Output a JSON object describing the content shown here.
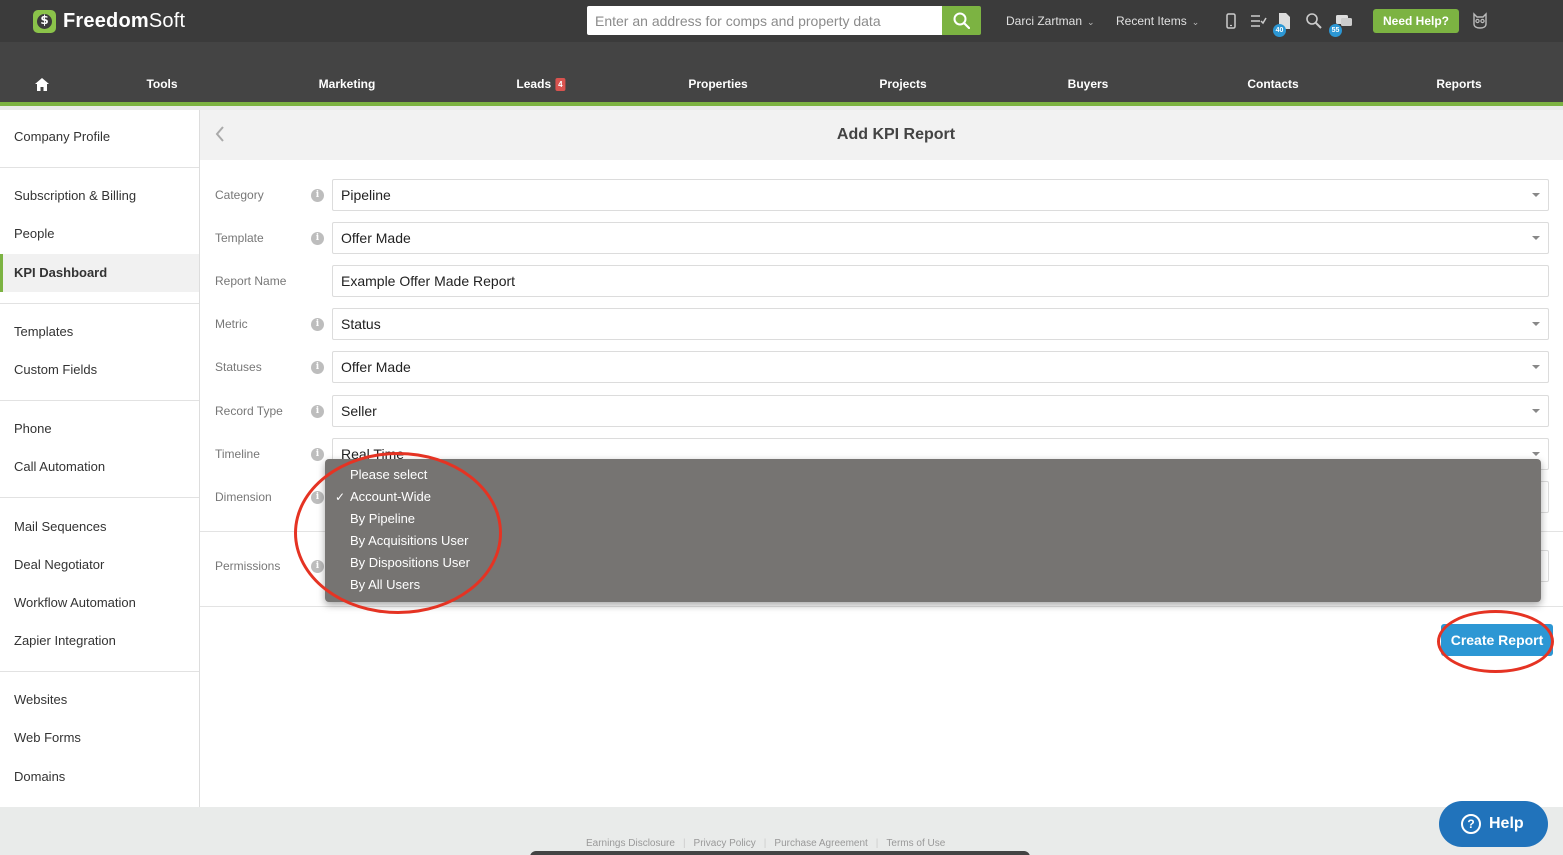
{
  "app": {
    "logo_symbol": "$",
    "logo_text_bold": "Freedom",
    "logo_text": "Soft"
  },
  "search": {
    "placeholder": "Enter an address for comps and property data"
  },
  "topbar": {
    "user": "Darci Zartman",
    "recent": "Recent Items",
    "badge_docs": "40",
    "badge_messages": "55",
    "help": "Need Help?"
  },
  "nav": {
    "tools": "Tools",
    "marketing": "Marketing",
    "leads": "Leads",
    "leads_count": "4",
    "properties": "Properties",
    "projects": "Projects",
    "buyers": "Buyers",
    "contacts": "Contacts",
    "reports": "Reports"
  },
  "sidebar": {
    "items": [
      "Company Profile",
      "Subscription & Billing",
      "People",
      "KPI Dashboard",
      "Templates",
      "Custom Fields",
      "Phone",
      "Call Automation",
      "Mail Sequences",
      "Deal Negotiator",
      "Workflow Automation",
      "Zapier Integration",
      "Websites",
      "Web Forms",
      "Domains"
    ]
  },
  "form": {
    "title": "Add KPI Report",
    "category_label": "Category",
    "category_value": "Pipeline",
    "template_label": "Template",
    "template_value": "Offer Made",
    "report_name_label": "Report Name",
    "report_name_value": "Example Offer Made Report",
    "metric_label": "Metric",
    "metric_value": "Status",
    "statuses_label": "Statuses",
    "statuses_value": "Offer Made",
    "record_type_label": "Record Type",
    "record_type_value": "Seller",
    "timeline_label": "Timeline",
    "timeline_value": "Real Time",
    "dimension_label": "Dimension",
    "permissions_label": "Permissions",
    "create_button": "Create Report"
  },
  "dimension_menu": {
    "options": [
      "Please select",
      "Account-Wide",
      "By Pipeline",
      "By Acquisitions User",
      "By Dispositions User",
      "By All Users"
    ],
    "selected": "Account-Wide",
    "check": "✓"
  },
  "footer": {
    "links": [
      "Earnings Disclosure",
      "Privacy Policy",
      "Purchase Agreement",
      "Terms of Use"
    ],
    "help": "Help",
    "help_q": "?"
  },
  "colors": {
    "accent": "#7cb342",
    "primary": "#2c97d4",
    "annotation": "#e53323"
  }
}
